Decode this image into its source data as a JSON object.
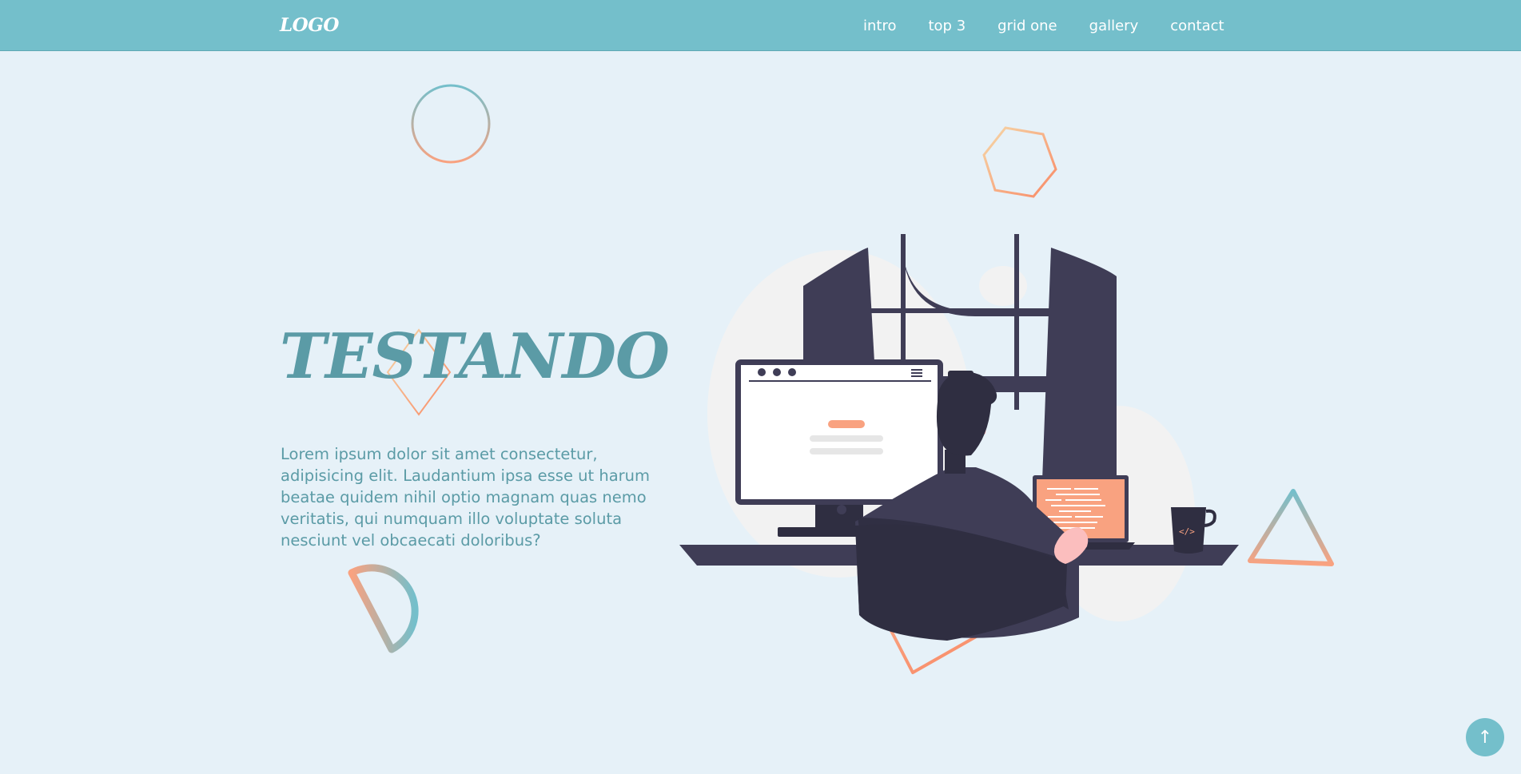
{
  "header": {
    "logo": "LOGO",
    "nav": [
      {
        "label": "intro"
      },
      {
        "label": "top 3"
      },
      {
        "label": "grid one"
      },
      {
        "label": "gallery"
      },
      {
        "label": "contact"
      }
    ]
  },
  "hero": {
    "title": "TESTANDO",
    "text": "Lorem ipsum dolor sit amet consectetur, adipisicing elit. Laudantium ipsa esse ut harum beatae quidem nihil optio magnam quas nemo veritatis, qui numquam illo voluptate soluta nesciunt vel obcaecati doloribus?",
    "illustration": "person-at-desk-with-computer"
  },
  "decorations": [
    "circle-outline",
    "hexagon-outline",
    "diamond-outline",
    "half-circle-outline",
    "triangle-outline",
    "triangle-outline"
  ],
  "scroll_top": {
    "icon": "arrow-up-icon",
    "glyph": "↑"
  },
  "colors": {
    "header": "#74bfcb",
    "background": "#e6f1f8",
    "title": "#5b9ba6",
    "accent": "#f9a280",
    "dark": "#3f3d56"
  }
}
